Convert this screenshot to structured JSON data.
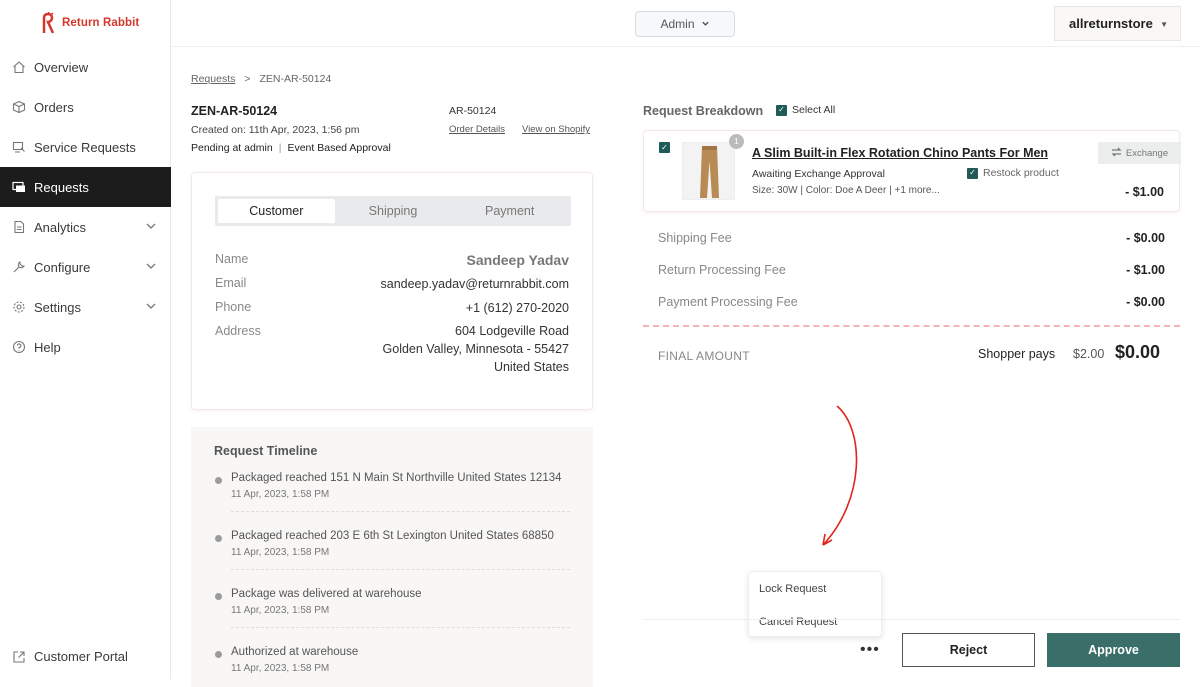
{
  "brand": {
    "name": "Return Rabbit",
    "color": "#d6372b"
  },
  "sidebar": {
    "items": [
      {
        "label": "Overview",
        "icon": "home-icon"
      },
      {
        "label": "Orders",
        "icon": "box-icon"
      },
      {
        "label": "Service Requests",
        "icon": "service-icon"
      },
      {
        "label": "Requests",
        "icon": "requests-icon",
        "active": true
      },
      {
        "label": "Analytics",
        "icon": "analytics-icon",
        "expandable": true
      },
      {
        "label": "Configure",
        "icon": "wrench-icon",
        "expandable": true
      },
      {
        "label": "Settings",
        "icon": "gear-icon",
        "expandable": true
      },
      {
        "label": "Help",
        "icon": "help-icon"
      }
    ],
    "customer_portal": "Customer Portal"
  },
  "header": {
    "role": "Admin",
    "store": "allreturnstore"
  },
  "breadcrumb": {
    "root": "Requests",
    "separator": ">",
    "current": "ZEN-AR-50124"
  },
  "request": {
    "id": "ZEN-AR-50124",
    "created": "Created on: 11th Apr, 2023, 1:56 pm",
    "status": "Pending at admin",
    "approval": "Event Based Approval",
    "ar_id": "AR-50124",
    "order_details": "Order Details",
    "view_shopify": "View on Shopify"
  },
  "customer_card": {
    "tabs": [
      "Customer",
      "Shipping",
      "Payment"
    ],
    "active_tab": 0,
    "name_label": "Name",
    "name": "Sandeep Yadav",
    "email_label": "Email",
    "email": "sandeep.yadav@returnrabbit.com",
    "phone_label": "Phone",
    "phone": "+1 (612) 270-2020",
    "address_label": "Address",
    "address_line1": "604 Lodgeville Road",
    "address_line2": "Golden Valley, Minnesota - 55427",
    "address_line3": "United States"
  },
  "timeline": {
    "title": "Request Timeline",
    "events": [
      {
        "text": "Packaged reached 151 N Main St Northville United States 12134",
        "time": "11 Apr, 2023, 1:58 PM"
      },
      {
        "text": "Packaged reached 203 E 6th St Lexington United States 68850",
        "time": "11 Apr, 2023, 1:58 PM"
      },
      {
        "text": "Package was delivered at warehouse",
        "time": "11 Apr, 2023, 1:58 PM"
      },
      {
        "text": "Authorized at warehouse",
        "time": "11 Apr, 2023, 1:58 PM"
      }
    ]
  },
  "breakdown": {
    "title": "Request Breakdown",
    "select_all": "Select All",
    "item": {
      "quantity": "1",
      "title": "A Slim Built-in Flex Rotation Chino Pants For Men",
      "status": "Awaiting Exchange Approval",
      "meta": "Size: 30W | Color: Doe A Deer | +1 more...",
      "restock": "Restock product",
      "type": "Exchange",
      "price": "- $1.00"
    },
    "fees": [
      {
        "label": "Shipping Fee",
        "amount": "- $0.00"
      },
      {
        "label": "Return Processing Fee",
        "amount": "- $1.00"
      },
      {
        "label": "Payment Processing Fee",
        "amount": "- $0.00"
      }
    ],
    "final_label": "FINAL AMOUNT",
    "shopper_pays": "Shopper pays",
    "original_amount": "$2.00",
    "final_amount": "$0.00"
  },
  "actions": {
    "menu": [
      "Lock Request",
      "Cancel Request"
    ],
    "more": "•••",
    "reject": "Reject",
    "approve": "Approve",
    "approve_color": "#3a6e68"
  }
}
